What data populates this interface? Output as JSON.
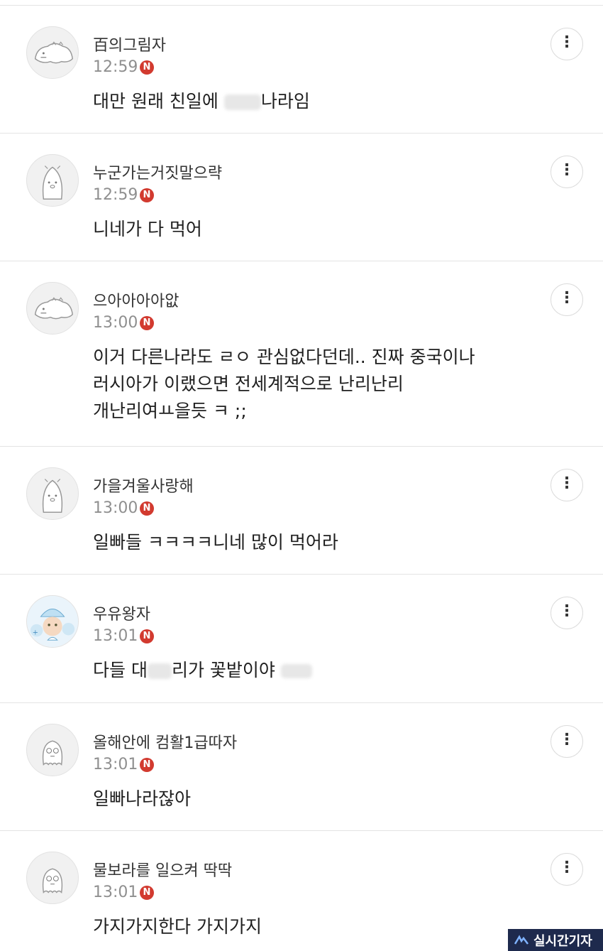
{
  "comments": [
    {
      "nickname": "百의그림자",
      "time": "12:59",
      "badge": "N",
      "lines": [
        "대만 원래 친일에 ",
        "나라임"
      ],
      "avatar": "dino-icon"
    },
    {
      "nickname": "누군가는거짓말으략",
      "time": "12:59",
      "badge": "N",
      "lines": [
        "니네가 다 먹어"
      ],
      "avatar": "penguin-icon"
    },
    {
      "nickname": "으아아아아앖",
      "time": "13:00",
      "badge": "N",
      "lines": [
        "이거 다른나라도 ㄹㅇ 관심없다던데.. 진짜 중국이나",
        "러시아가 이랬으면 전세계적으로 난리난리",
        "개난리여ㅛ을듯 ㅋ ;;"
      ],
      "avatar": "dino-icon"
    },
    {
      "nickname": "가을겨울사랑해",
      "time": "13:00",
      "badge": "N",
      "lines": [
        "일빠들 ㅋㅋㅋㅋ니네 많이 먹어라"
      ],
      "avatar": "penguin-icon"
    },
    {
      "nickname": "우유왕자",
      "time": "13:01",
      "badge": "N",
      "lines": [
        "다들 대",
        "리가 꽃밭이야 "
      ],
      "avatar": "character-icon"
    },
    {
      "nickname": "올해안에 컴활1급따자",
      "time": "13:01",
      "badge": "N",
      "lines": [
        "일빠나라잖아"
      ],
      "avatar": "ghost-icon"
    },
    {
      "nickname": "물보라를 일으켜 딱딱",
      "time": "13:01",
      "badge": "N",
      "lines": [
        "가지가지한다 가지가지"
      ],
      "avatar": "ghost-icon"
    }
  ],
  "more_label": "⋮",
  "watermark": "실시간기자",
  "colors": {
    "badge": "#d23a2f",
    "divider": "#e4e4e4",
    "watermark_bg": "#1e2a4d"
  }
}
